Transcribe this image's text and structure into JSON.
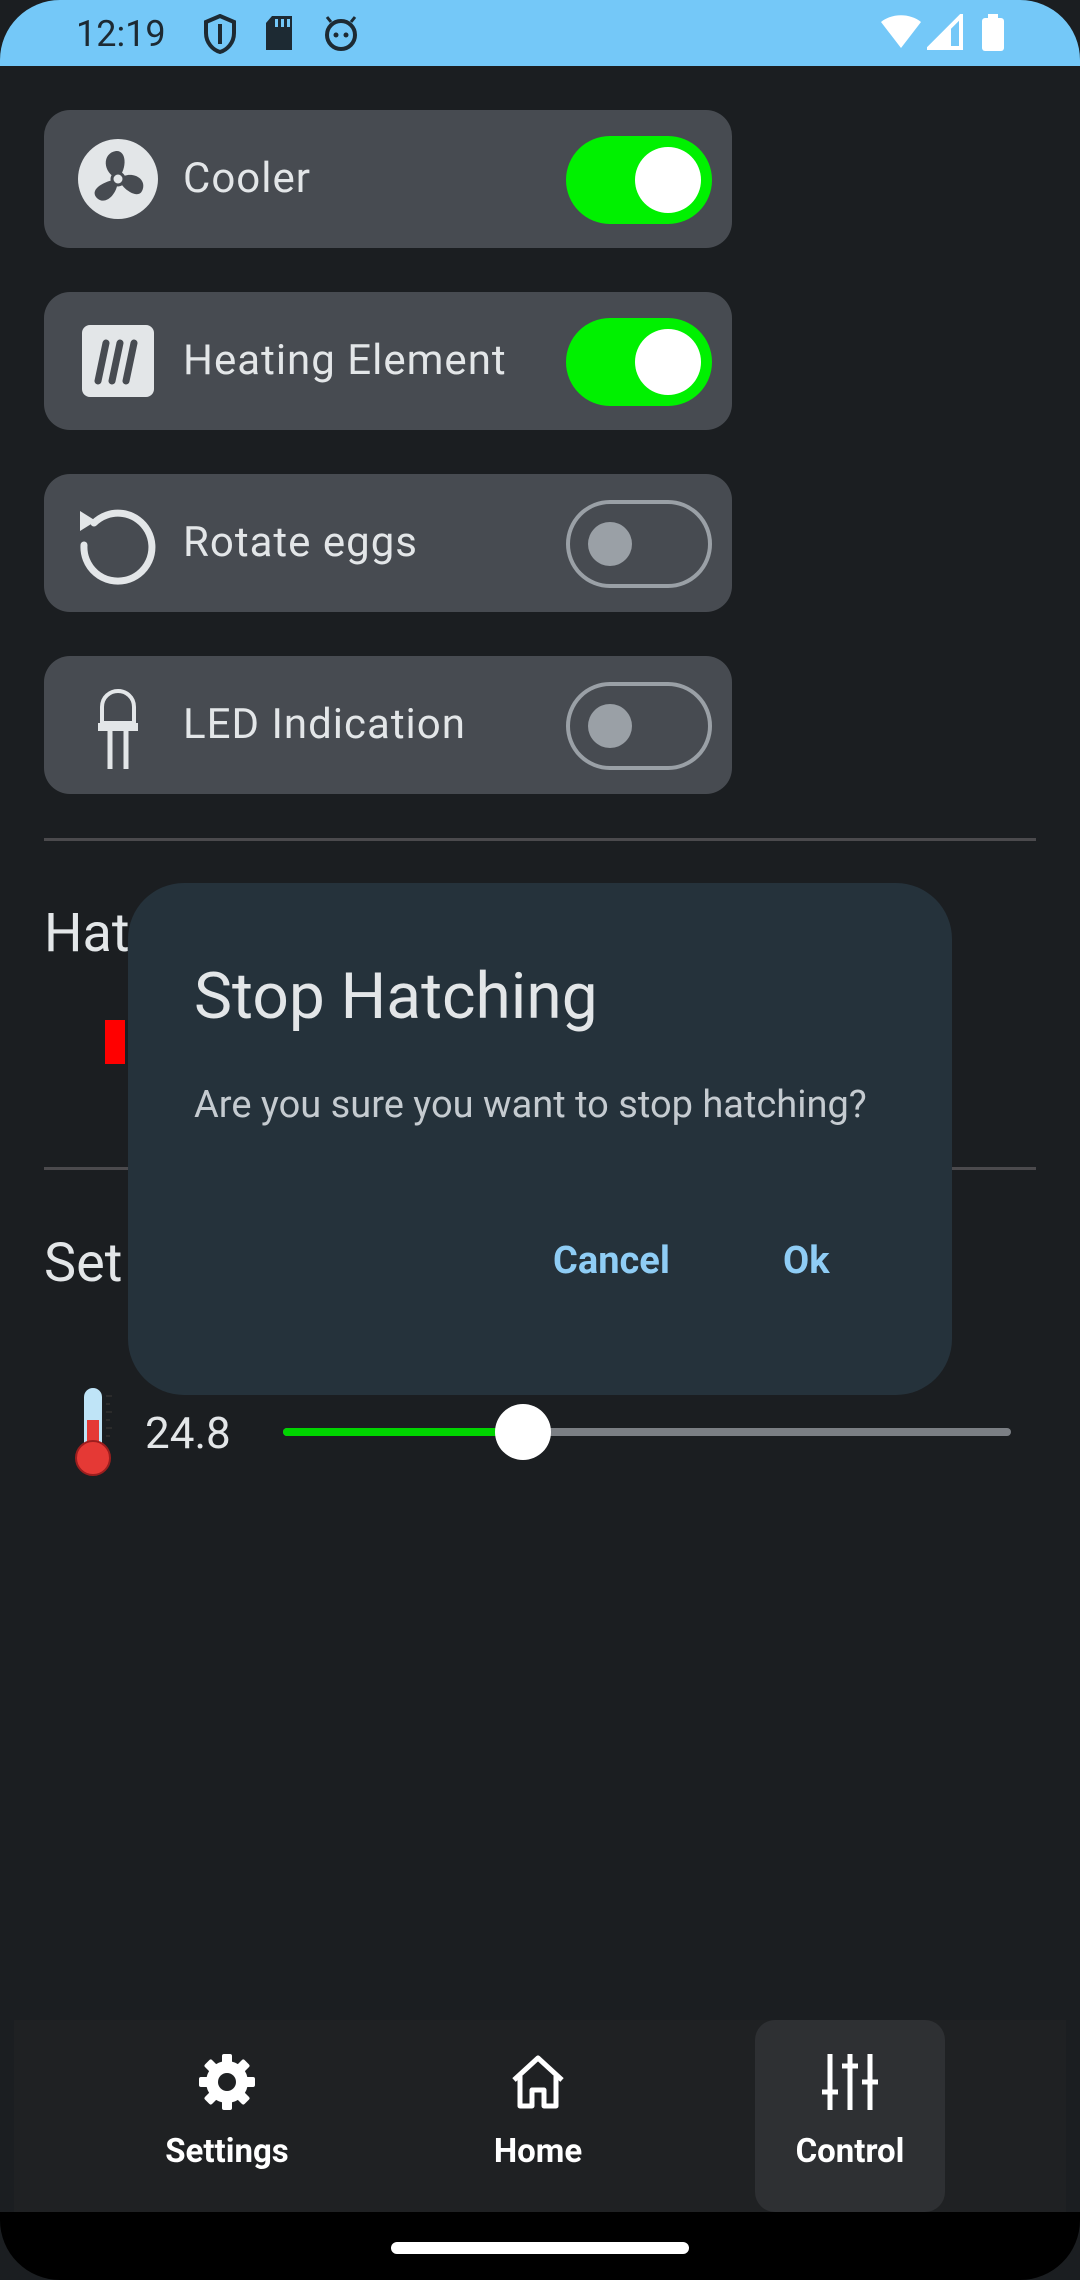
{
  "status_bar": {
    "time": "12:19"
  },
  "controls": [
    {
      "label": "Cooler",
      "icon": "fan-icon",
      "on": true
    },
    {
      "label": "Heating Element",
      "icon": "heating-element-icon",
      "on": true
    },
    {
      "label": "Rotate eggs",
      "icon": "rotate-icon",
      "on": false
    },
    {
      "label": "LED Indication",
      "icon": "led-icon",
      "on": false
    }
  ],
  "hatching_section": {
    "heading": "Hat"
  },
  "setpoint_section": {
    "heading": "Set"
  },
  "temperature": {
    "value": "24.8",
    "slider_fraction": 0.33,
    "icon": "thermometer-icon"
  },
  "dialog": {
    "title": "Stop Hatching",
    "message": "Are you sure you want to stop hatching?",
    "cancel_label": "Cancel",
    "ok_label": "Ok"
  },
  "bottom_nav": {
    "items": [
      {
        "label": "Settings",
        "icon": "gear-icon"
      },
      {
        "label": "Home",
        "icon": "home-icon"
      },
      {
        "label": "Control",
        "icon": "sliders-icon",
        "selected": true
      }
    ]
  },
  "colors": {
    "switch_on": "#00f100",
    "dialog_button": "#8fcdf5",
    "status_bar": "#74c8f8"
  }
}
